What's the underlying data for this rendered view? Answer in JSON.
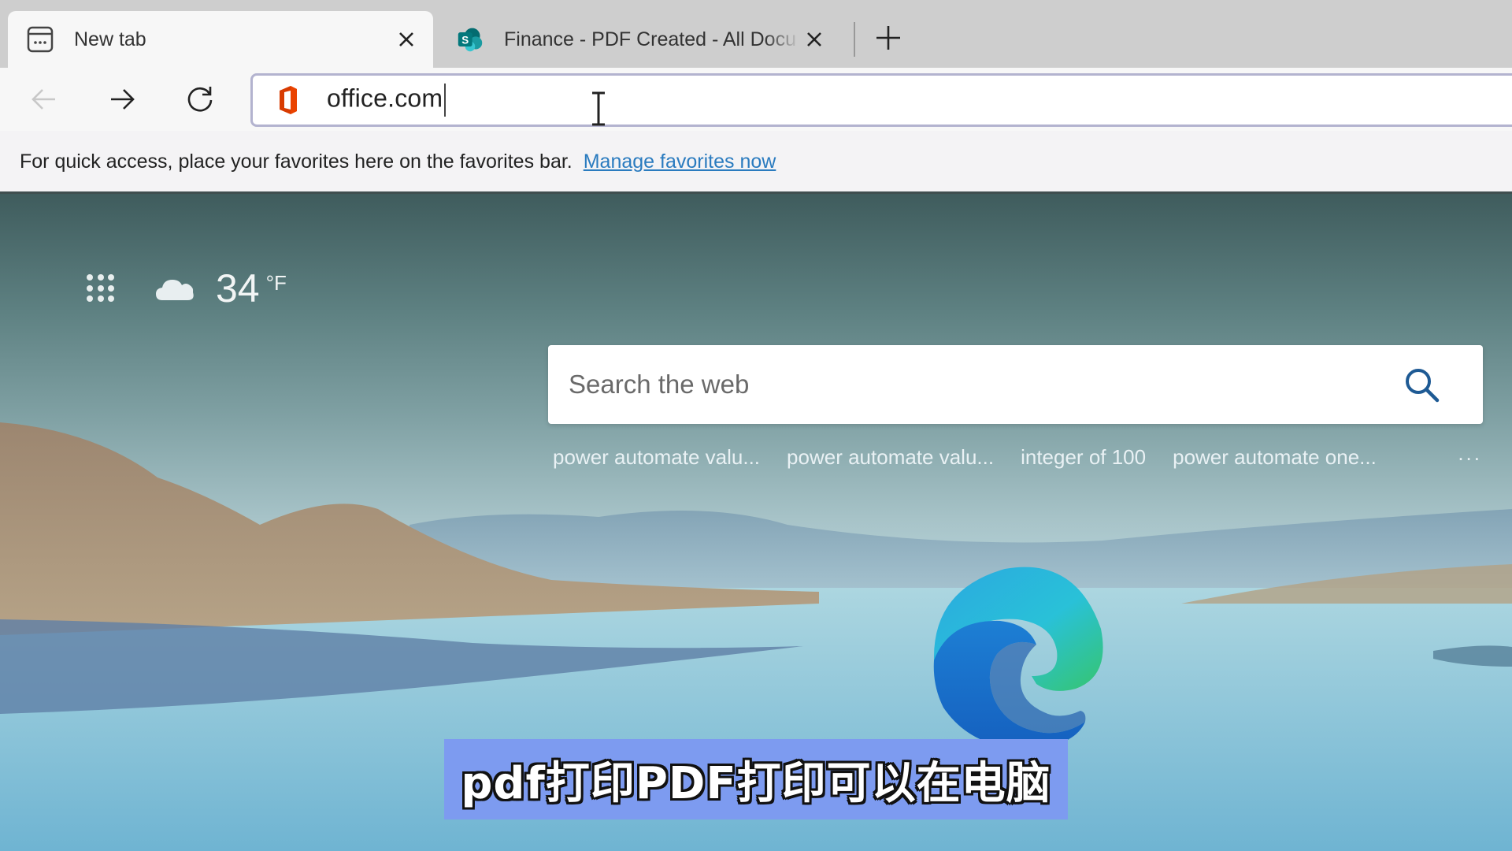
{
  "browser": {
    "tabs": [
      {
        "title": "New tab",
        "icon": "new-tab-page-icon",
        "active": true
      },
      {
        "title": "Finance - PDF Created - All Docu",
        "icon": "sharepoint-icon",
        "active": false
      }
    ],
    "new_tab_button": "+",
    "toolbar": {
      "back": "back-arrow-icon",
      "forward": "forward-arrow-icon",
      "refresh": "refresh-icon",
      "address_value": "office.com",
      "address_icon": "office-icon"
    },
    "favorites_bar": {
      "message": "For quick access, place your favorites here on the favorites bar.",
      "link": "Manage favorites now"
    }
  },
  "page": {
    "apps_icon": "app-launcher-grid-icon",
    "weather": {
      "icon": "cloud-icon",
      "temperature": "34",
      "unit": "°F"
    },
    "search": {
      "placeholder": "Search the web",
      "value": ""
    },
    "suggestions": [
      "power automate valu...",
      "power automate valu...",
      "integer of 100",
      "power automate one..."
    ],
    "more_label": "...",
    "logo": "microsoft-edge-logo"
  },
  "overlay": {
    "subtitle": "pdf打印PDF打印可以在电脑"
  },
  "colors": {
    "link": "#2a7bbf",
    "subtitle_bg": "#7d9bf0",
    "tabstrip_bg": "#cecece",
    "search_icon": "#1e5a94",
    "office_red": "#d83b01"
  }
}
